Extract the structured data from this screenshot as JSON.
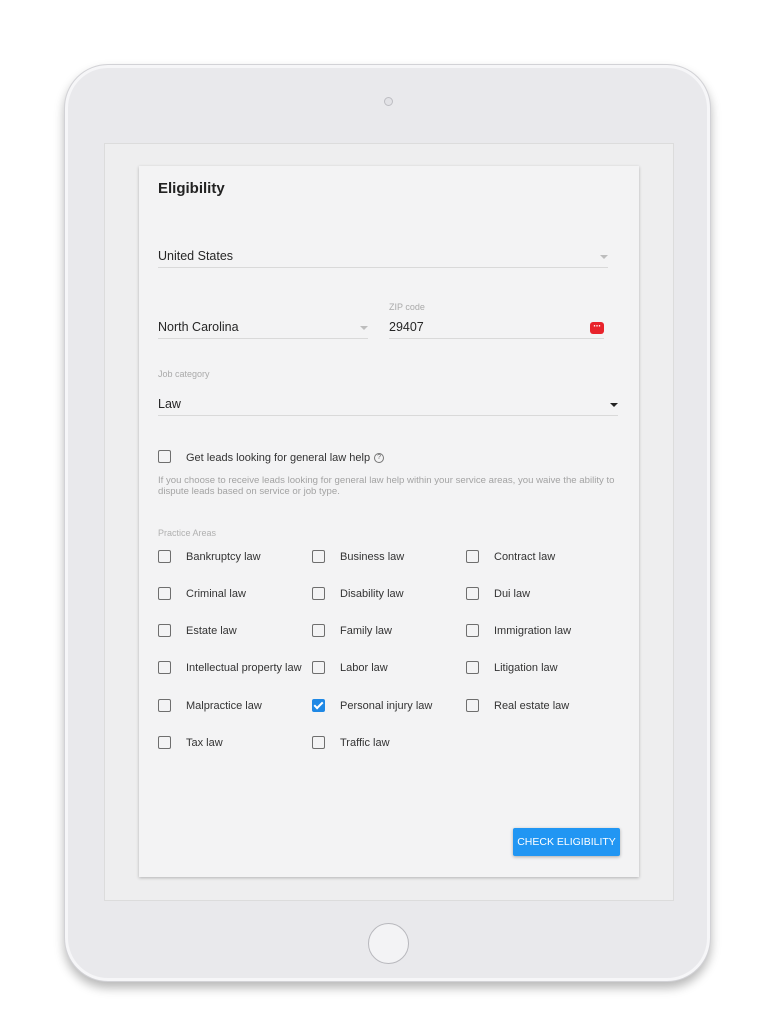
{
  "form": {
    "title": "Eligibility",
    "country": "United States",
    "state": "North Carolina",
    "zip_label": "ZIP code",
    "zip_value": "29407",
    "job_category_label": "Job category",
    "job_category_value": "Law",
    "general_help_label": "Get leads looking for general law help",
    "general_help_icon": "?",
    "disclaimer": "If you choose to receive leads looking for general law help within your service areas, you waive the ability to dispute leads based on service or job type.",
    "practice_areas_label": "Practice Areas",
    "submit_label": "CHECK ELIGIBILITY"
  },
  "practice_areas": [
    {
      "label": "Bankruptcy law",
      "checked": false
    },
    {
      "label": "Business law",
      "checked": false
    },
    {
      "label": "Contract law",
      "checked": false
    },
    {
      "label": "Criminal law",
      "checked": false
    },
    {
      "label": "Disability law",
      "checked": false
    },
    {
      "label": "Dui law",
      "checked": false
    },
    {
      "label": "Estate law",
      "checked": false
    },
    {
      "label": "Family law",
      "checked": false
    },
    {
      "label": "Immigration law",
      "checked": false
    },
    {
      "label": "Intellectual property law",
      "checked": false
    },
    {
      "label": "Labor law",
      "checked": false
    },
    {
      "label": "Litigation law",
      "checked": false
    },
    {
      "label": "Malpractice law",
      "checked": false
    },
    {
      "label": "Personal injury law",
      "checked": true
    },
    {
      "label": "Real estate law",
      "checked": false
    },
    {
      "label": "Tax law",
      "checked": false
    },
    {
      "label": "Traffic law",
      "checked": false
    }
  ],
  "colors": {
    "accent": "#2196f3",
    "zip_icon": "#e8232b"
  },
  "icons": {
    "zip_field": "password-manager-icon",
    "help": "help-circle-icon",
    "dropdown": "caret-down-icon"
  }
}
